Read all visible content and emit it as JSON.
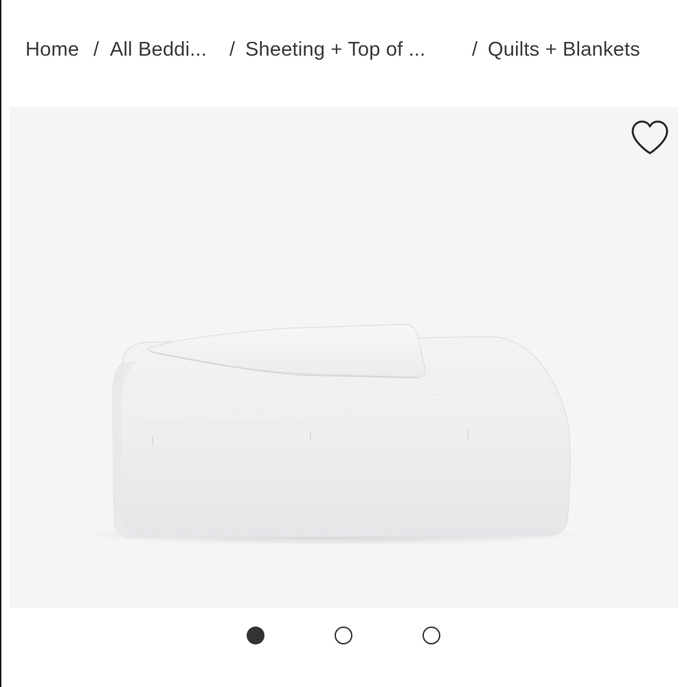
{
  "breadcrumb": {
    "items": [
      {
        "label": "Home"
      },
      {
        "label": "All Beddi..."
      },
      {
        "label": "Sheeting + Top of ..."
      },
      {
        "label": "Quilts + Blankets"
      }
    ],
    "separator": "/"
  },
  "product": {
    "image_icon": "folded-quilt-image",
    "wishlist_icon": "heart-outline-icon"
  },
  "carousel": {
    "total": 3,
    "active_index": 0
  },
  "colors": {
    "text": "#3a3a3a",
    "image_bg": "#f5f5f5",
    "dot": "#333333"
  }
}
